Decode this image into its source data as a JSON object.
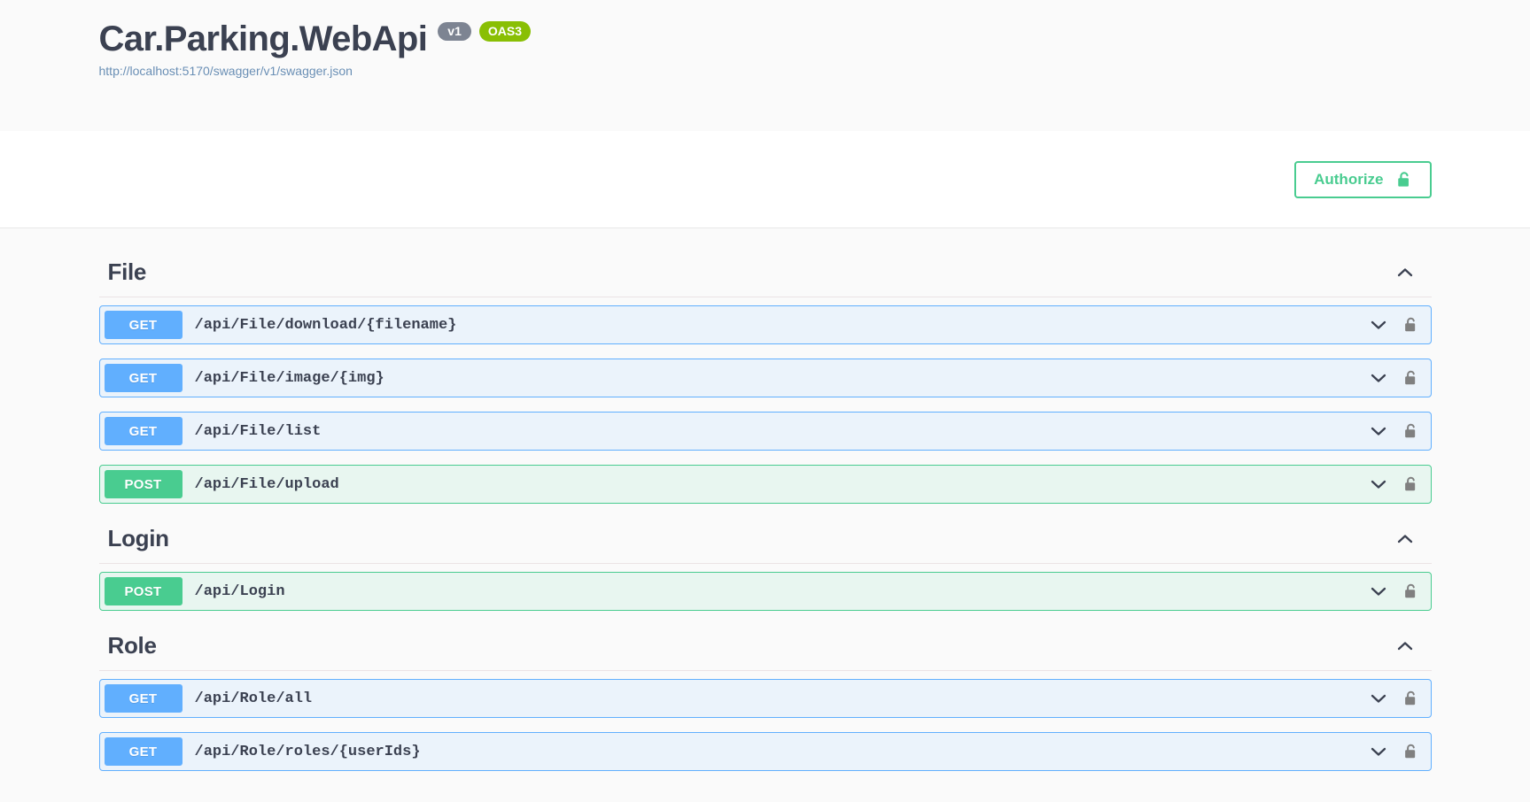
{
  "header": {
    "title": "Car.Parking.WebApi",
    "version_badge": "v1",
    "spec_badge": "OAS3",
    "spec_url": "http://localhost:5170/swagger/v1/swagger.json",
    "version_badge_color": "#7d8492",
    "spec_badge_color": "#89bf04",
    "title_color": "#3b4151",
    "link_color": "#6a8fb5"
  },
  "auth": {
    "authorize_label": "Authorize",
    "lock_icon": "unlock-icon",
    "accent_color": "#49cc90"
  },
  "icons": {
    "chevron_down": "chevron-down-icon",
    "chevron_up": "chevron-up-icon",
    "lock": "unlock-icon"
  },
  "colors": {
    "get_badge": "#61affe",
    "get_row_bg": "#ebf3fb",
    "post_badge": "#49cc90",
    "post_row_bg": "#e8f6f0",
    "page_bg": "#fafafa",
    "tag_underline": "#ebe3e5"
  },
  "sections": [
    {
      "name": "File",
      "expanded": true,
      "operations": [
        {
          "method": "GET",
          "path": "/api/File/download/{filename}"
        },
        {
          "method": "GET",
          "path": "/api/File/image/{img}"
        },
        {
          "method": "GET",
          "path": "/api/File/list"
        },
        {
          "method": "POST",
          "path": "/api/File/upload"
        }
      ]
    },
    {
      "name": "Login",
      "expanded": true,
      "operations": [
        {
          "method": "POST",
          "path": "/api/Login"
        }
      ]
    },
    {
      "name": "Role",
      "expanded": true,
      "operations": [
        {
          "method": "GET",
          "path": "/api/Role/all"
        },
        {
          "method": "GET",
          "path": "/api/Role/roles/{userIds}"
        }
      ]
    }
  ]
}
